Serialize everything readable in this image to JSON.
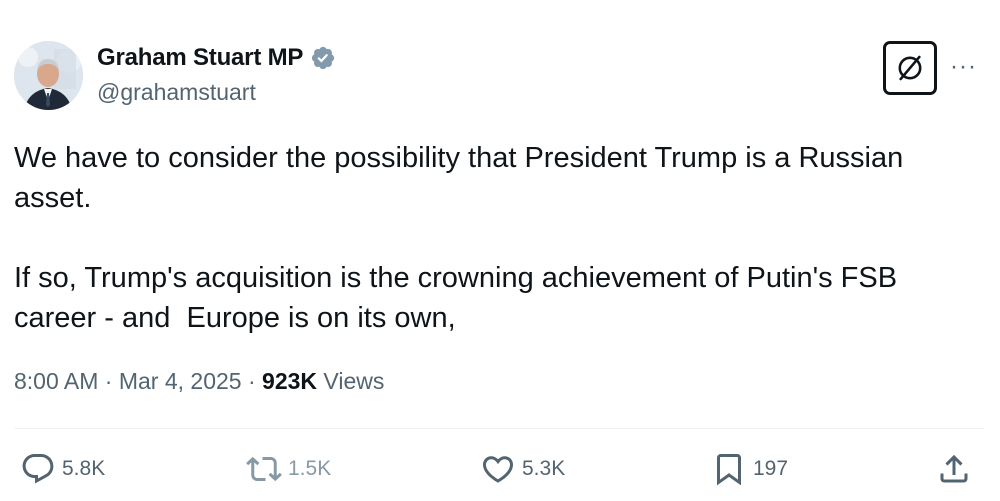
{
  "author": {
    "display_name": "Graham Stuart MP",
    "handle": "@grahamstuart",
    "verified": true,
    "verified_color": "#829aab"
  },
  "header_actions": {
    "grok_icon": "grok-icon",
    "more_icon": "more-icon",
    "more_label": "···"
  },
  "tweet": {
    "paragraphs": [
      "We have to consider the possibility that President Trump is a Russian asset.",
      "If so, Trump's acquisition is the crowning achievement of Putin's FSB career - and  Europe is on its own,"
    ]
  },
  "meta": {
    "time": "8:00 AM",
    "separator": " · ",
    "date": "Mar 4, 2025",
    "views_count": "923K",
    "views_label": " Views"
  },
  "actions": {
    "reply": {
      "icon": "reply-icon",
      "count": "5.8K"
    },
    "repost": {
      "icon": "repost-icon",
      "count": "1.5K"
    },
    "like": {
      "icon": "like-icon",
      "count": "5.3K"
    },
    "bookmark": {
      "icon": "bookmark-icon",
      "count": "197"
    },
    "share": {
      "icon": "share-icon"
    }
  },
  "colors": {
    "text": "#0f1419",
    "secondary": "#536471",
    "divider": "#eff3f4"
  }
}
